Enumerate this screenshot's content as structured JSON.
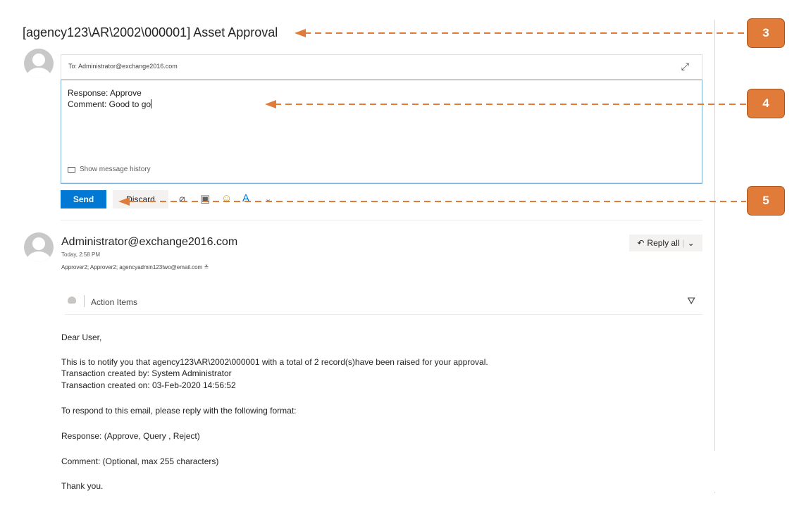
{
  "subject": "[agency123\\AR\\2002\\000001] Asset Approval",
  "reply": {
    "to": "To: Administrator@exchange2016.com",
    "body_lines": [
      "Response: Approve",
      "Comment: Good to go"
    ],
    "show_history": "Show message history",
    "send_label": "Send",
    "discard_label": "Discard"
  },
  "message": {
    "sender": "Administrator@exchange2016.com",
    "time": "Today, 2:58 PM",
    "recipients": "Approver2; Approver2; agencyadmin123two@email.com",
    "reply_all_label": "Reply all",
    "action_items_label": "Action Items",
    "body": {
      "greeting": "Dear User,",
      "line1": "This is to notify you that agency123\\AR\\2002\\000001 with a total of 2 record(s)have been raised for your approval.",
      "line2": "Transaction created by: System Administrator",
      "line3": "Transaction created on: 03-Feb-2020 14:56:52",
      "line4": "To respond to this email, please reply with the following format:",
      "line5": "Response: (Approve, Query , Reject)",
      "line6": "Comment: (Optional, max 255 characters)",
      "closing": "Thank you."
    }
  },
  "annotations": {
    "badge3": "3",
    "badge4": "4",
    "badge5": "5"
  },
  "colors": {
    "accent": "#0078d4",
    "annotation": "#e07b39"
  },
  "icons": [
    "avatar-icon",
    "expand-icon",
    "envelope-icon",
    "paperclip-icon",
    "image-icon",
    "emoji-icon",
    "format-icon",
    "chevron-down-icon",
    "reply-all-icon",
    "action-items-icon",
    "store-bag-icon"
  ]
}
